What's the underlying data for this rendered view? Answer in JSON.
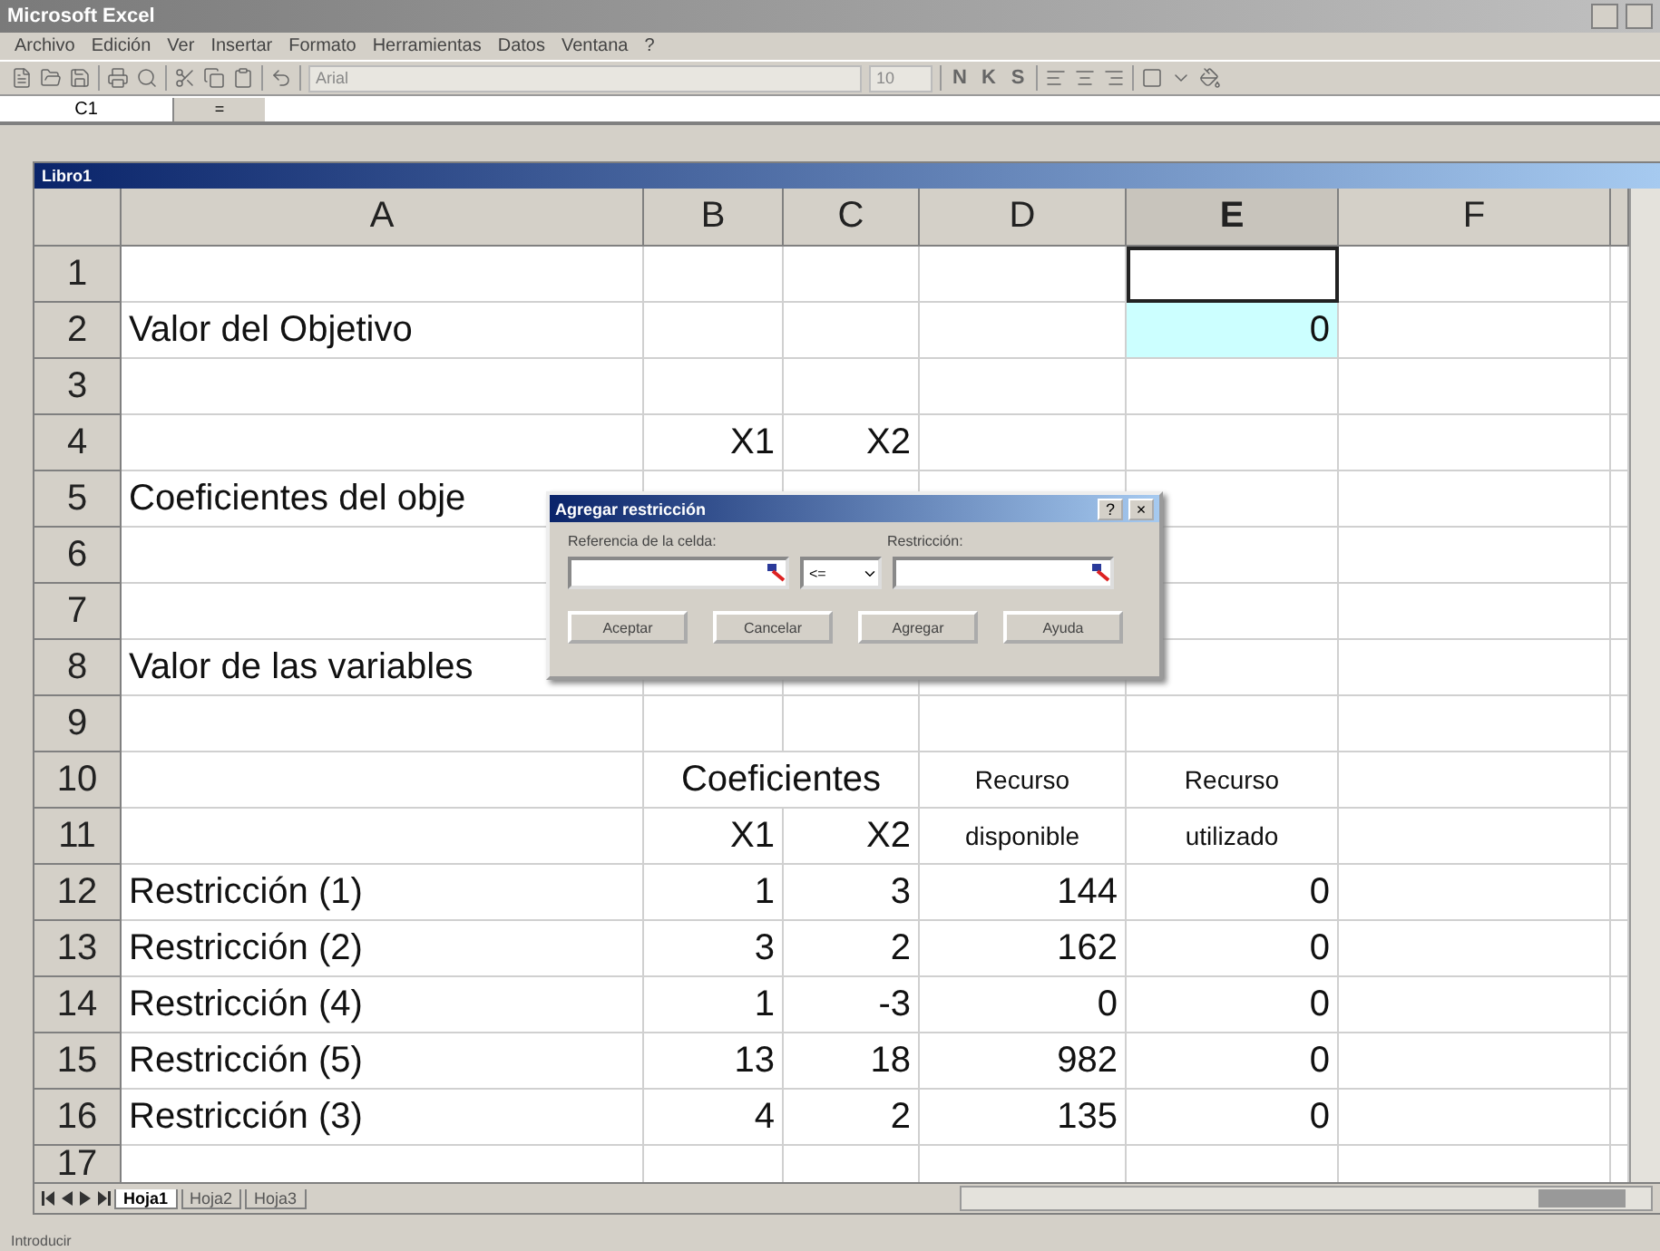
{
  "window": {
    "title": "Microsoft Excel"
  },
  "menu": [
    "Archivo",
    "Edición",
    "Ver",
    "Insertar",
    "Formato",
    "Herramientas",
    "Datos",
    "Ventana",
    "?"
  ],
  "toolbar": {
    "font": "Arial",
    "size": "10",
    "format_buttons": [
      "N",
      "K",
      "S"
    ]
  },
  "formula_bar": {
    "name_box": "C1",
    "equals": "="
  },
  "workbook": {
    "title": "Libro1"
  },
  "columns": [
    {
      "label": "A",
      "active": false
    },
    {
      "label": "B",
      "active": false
    },
    {
      "label": "C",
      "active": false
    },
    {
      "label": "D",
      "active": false
    },
    {
      "label": "E",
      "active": true
    },
    {
      "label": "F",
      "active": false
    }
  ],
  "rows": [
    {
      "header": "1",
      "cells": {}
    },
    {
      "header": "2",
      "kind": "data",
      "cells": {
        "A": "Valor del Objetivo",
        "E": "0"
      },
      "e_highlighted": true
    },
    {
      "header": "3",
      "cells": {}
    },
    {
      "header": "4",
      "kind": "data",
      "cells": {
        "B": "X1",
        "C": "X2"
      }
    },
    {
      "header": "5",
      "kind": "data",
      "cells": {
        "A": "Coeficientes del obje"
      }
    },
    {
      "header": "6",
      "cells": {}
    },
    {
      "header": "7",
      "cells": {}
    },
    {
      "header": "8",
      "kind": "data",
      "cells": {
        "A": "Valor de las variables"
      }
    },
    {
      "header": "9",
      "cells": {}
    },
    {
      "header": "10",
      "kind": "heading",
      "cells": {
        "B": "Coeficientes",
        "D": "Recurso",
        "E": "Recurso"
      }
    },
    {
      "header": "11",
      "kind": "heading",
      "cells": {
        "B": "X1",
        "C": "X2",
        "D": "disponible",
        "E": "utilizado"
      }
    },
    {
      "header": "12",
      "kind": "data",
      "cells": {
        "A": "Restricción (1)",
        "B": "1",
        "C": "3",
        "D": "144",
        "E": "0"
      }
    },
    {
      "header": "13",
      "kind": "data",
      "cells": {
        "A": "Restricción (2)",
        "B": "3",
        "C": "2",
        "D": "162",
        "E": "0"
      }
    },
    {
      "header": "14",
      "kind": "data",
      "cells": {
        "A": "Restricción (4)",
        "B": "1",
        "C": "-3",
        "D": "0",
        "E": "0"
      }
    },
    {
      "header": "15",
      "kind": "data",
      "cells": {
        "A": "Restricción (5)",
        "B": "13",
        "C": "18",
        "D": "982",
        "E": "0"
      }
    },
    {
      "header": "16",
      "kind": "data",
      "cells": {
        "A": "Restricción (3)",
        "B": "4",
        "C": "2",
        "D": "135",
        "E": "0"
      }
    },
    {
      "header": "17",
      "cells": {}
    }
  ],
  "dialog": {
    "title": "Agregar restricción",
    "help": "?",
    "close": "×",
    "cell_reference_label": "Referencia de la celda:",
    "constraint_label": "Restricción:",
    "operator": "<=",
    "buttons": [
      "Aceptar",
      "Cancelar",
      "Agregar",
      "Ayuda"
    ]
  },
  "sheet_tabs": [
    {
      "label": "Hoja1",
      "selected": true
    },
    {
      "label": "Hoja2",
      "selected": false
    },
    {
      "label": "Hoja3",
      "selected": false
    }
  ],
  "status_bar": {
    "text": "Introducir"
  }
}
